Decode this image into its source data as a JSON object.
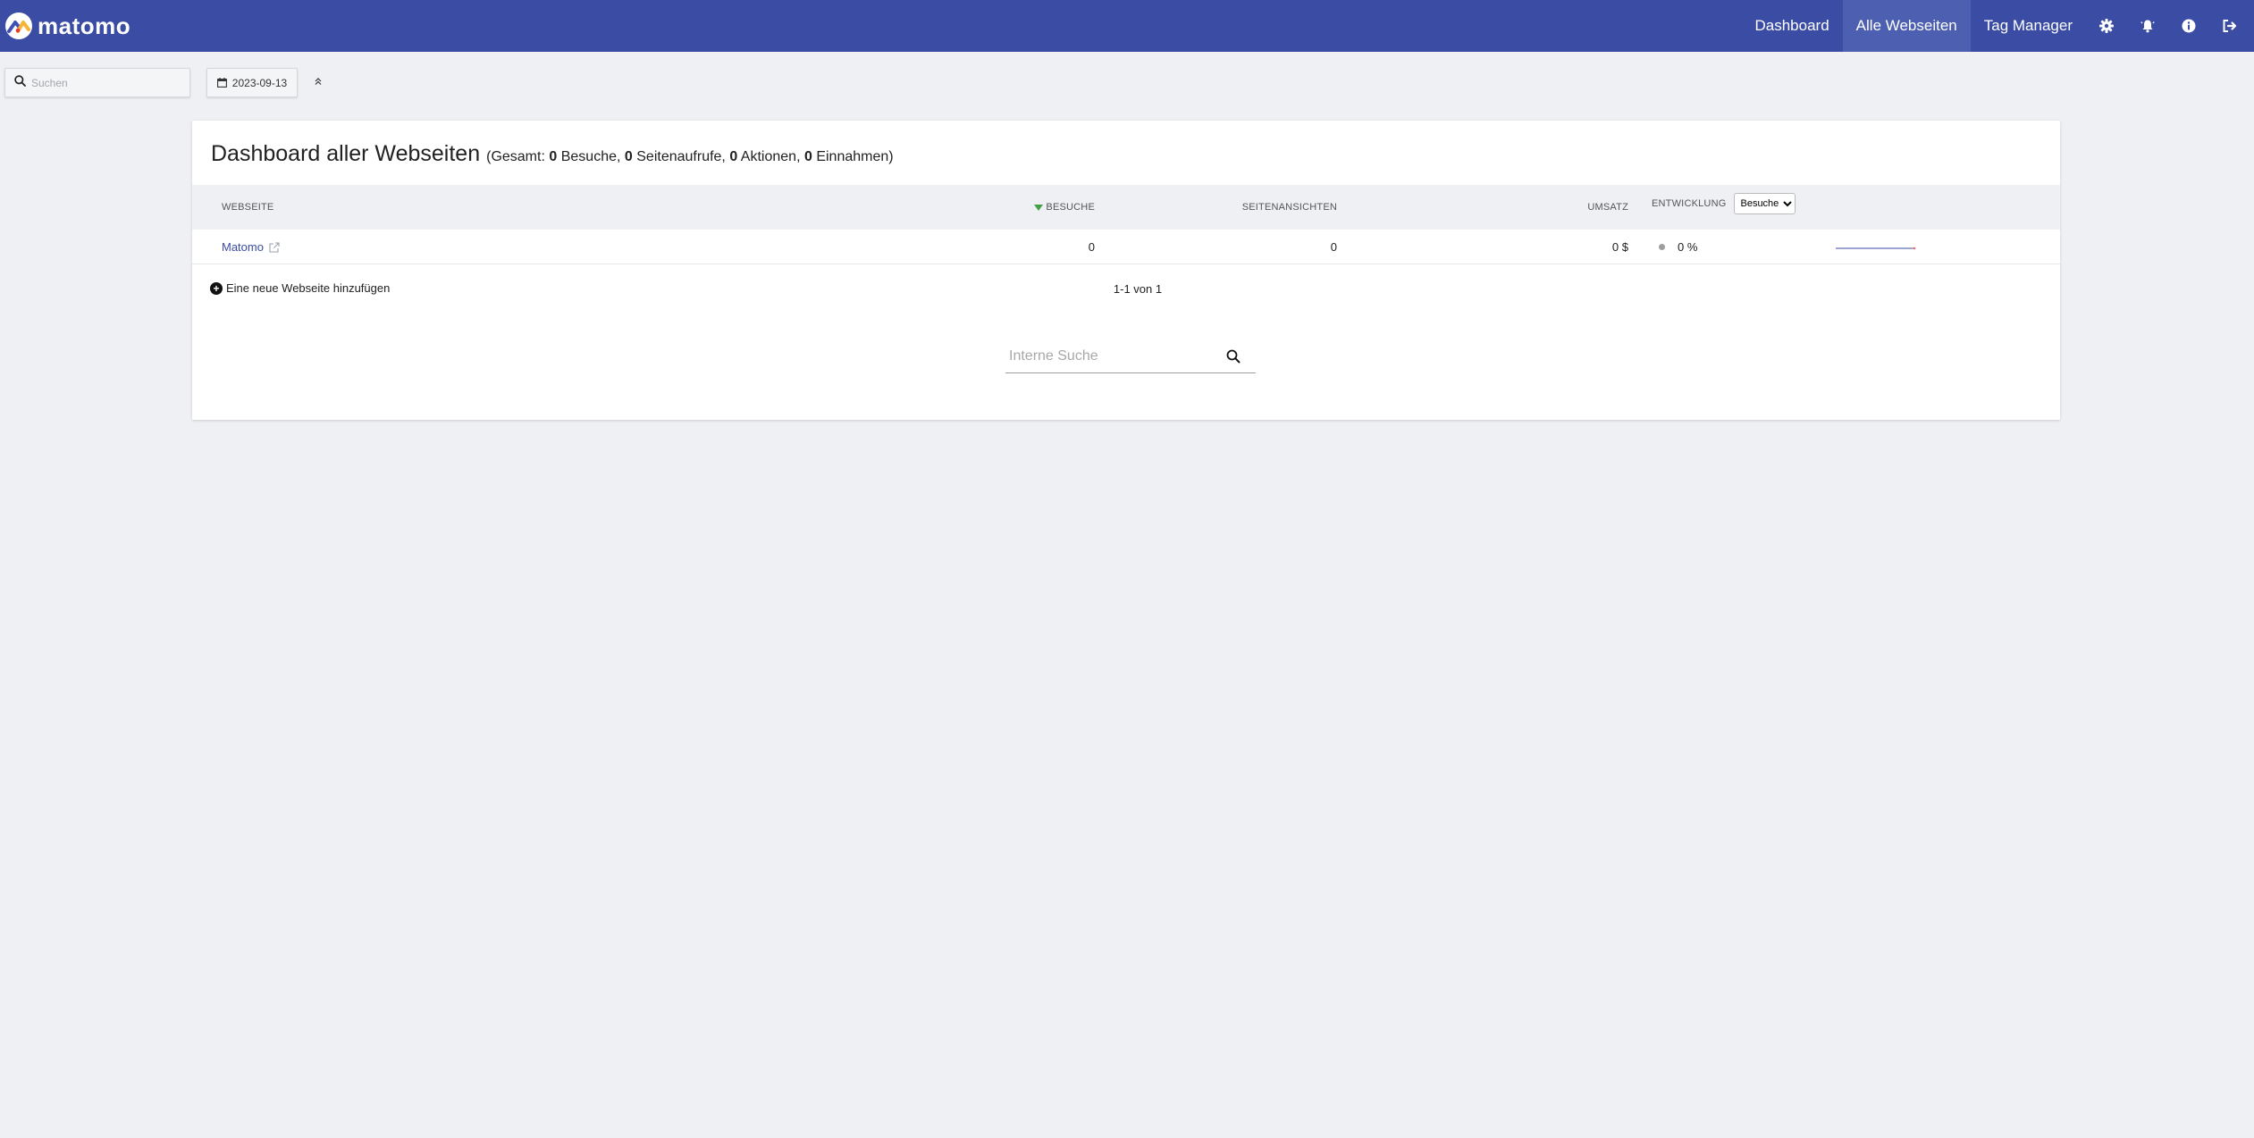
{
  "brand": {
    "name": "matomo"
  },
  "topnav": {
    "items": [
      {
        "label": "Dashboard",
        "active": false
      },
      {
        "label": "Alle Webseiten",
        "active": true
      },
      {
        "label": "Tag Manager",
        "active": false
      }
    ],
    "icons": [
      "gear-icon",
      "bell-icon",
      "info-icon",
      "logout-icon"
    ]
  },
  "toolbar": {
    "search_placeholder": "Suchen",
    "date": "2023-09-13"
  },
  "dashboard": {
    "title": "Dashboard aller Webseiten",
    "summary": {
      "prefix": "(Gesamt:",
      "visits": "0",
      "visits_label": "Besuche,",
      "pageviews": "0",
      "pageviews_label": "Seitenaufrufe,",
      "actions": "0",
      "actions_label": "Aktionen,",
      "revenue": "0",
      "revenue_label": "Einnahmen)"
    },
    "columns": {
      "site": "Webseite",
      "visits": "Besuche",
      "pageviews": "Seitenansichten",
      "revenue": "Umsatz",
      "evolution": "Entwicklung"
    },
    "evolution_select": {
      "selected": "Besuche",
      "options": [
        "Besuche"
      ]
    },
    "rows": [
      {
        "site": "Matomo",
        "visits": "0",
        "pageviews": "0",
        "revenue": "0 $",
        "evolution": "0 %"
      }
    ],
    "add_site_label": "Eine neue Webseite hinzufügen",
    "pagination": "1-1 von 1",
    "internal_search_placeholder": "Interne Suche"
  },
  "colors": {
    "header": "#3a4ca3",
    "header_active": "#4d5fb0",
    "link": "#3a4ca3",
    "sort_arrow": "#43a047",
    "background": "#eef0f3"
  }
}
